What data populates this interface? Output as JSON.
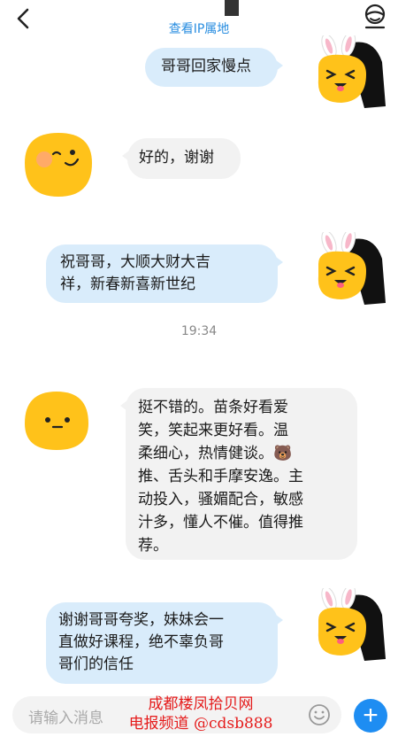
{
  "header": {
    "subtitle": "查看IP属地"
  },
  "messages": [
    {
      "side": "me",
      "text": "哥哥回家慢点"
    },
    {
      "side": "other",
      "text": "好的，谢谢"
    },
    {
      "side": "me",
      "lines": [
        "祝哥哥，大顺大财大吉",
        "祥，新春新喜新世纪"
      ]
    },
    {
      "side": "other",
      "lines": [
        "挺不错的。苗条好看爱",
        "笑，笑起来更好看。温",
        "柔细心，热情健谈。🐻",
        "推、舌头和手摩安逸。主",
        "动投入，骚媚配合，敏感",
        "汁多，懂人不催。值得推",
        "荐。"
      ]
    },
    {
      "side": "me",
      "lines": [
        "谢谢哥哥夸奖，妹妹会一",
        "直做好课程，绝不辜负哥",
        "哥们的信任"
      ]
    }
  ],
  "timestamp": "19:34",
  "input": {
    "placeholder": "请输入消息"
  },
  "watermark": {
    "line1": "成都楼凤拾贝网",
    "line2": "电报频道 @cdsb888"
  },
  "colors": {
    "accent": "#1e8df2",
    "bubble_me": "#d9ecfb",
    "bubble_other": "#f2f2f2",
    "watermark": "#e51b1b"
  }
}
